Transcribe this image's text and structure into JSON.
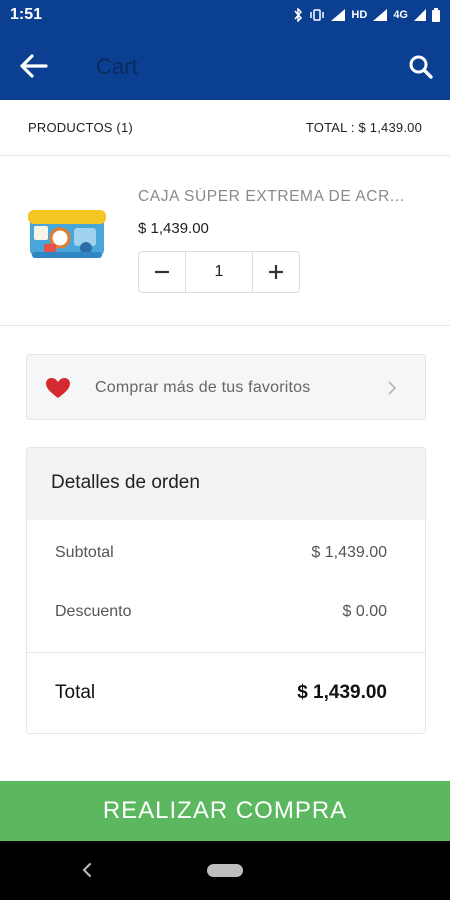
{
  "status_bar": {
    "time": "1:51",
    "network_label": "4G",
    "hd_label": "HD"
  },
  "app_bar": {
    "title": "Cart",
    "back_icon": "arrow-left-icon",
    "search_icon": "search-icon",
    "background_color": "#0a3f92"
  },
  "summary": {
    "products_label": "PRODUCTOS (1)",
    "total_label": "TOTAL : $ 1,439.00"
  },
  "product": {
    "name": "CAJA SÚPER EXTREMA DE ACR...",
    "price": "$ 1,439.00",
    "quantity": "1",
    "decrement_icon": "minus-icon",
    "increment_icon": "plus-icon"
  },
  "favorites_banner": {
    "text": "Comprar más de tus favoritos",
    "icon": "heart-icon",
    "chevron": "chevron-right-icon"
  },
  "order_details": {
    "title": "Detalles de orden",
    "subtotal_label": "Subtotal",
    "subtotal_value": "$ 1,439.00",
    "discount_label": "Descuento",
    "discount_value": "$ 0.00",
    "total_label": "Total",
    "total_value": "$ 1,439.00"
  },
  "checkout": {
    "label": "REALIZAR COMPRA",
    "color": "#5bb85f"
  },
  "nav_bar": {
    "back_icon": "nav-back-icon",
    "home_icon": "nav-home-pill-icon"
  }
}
